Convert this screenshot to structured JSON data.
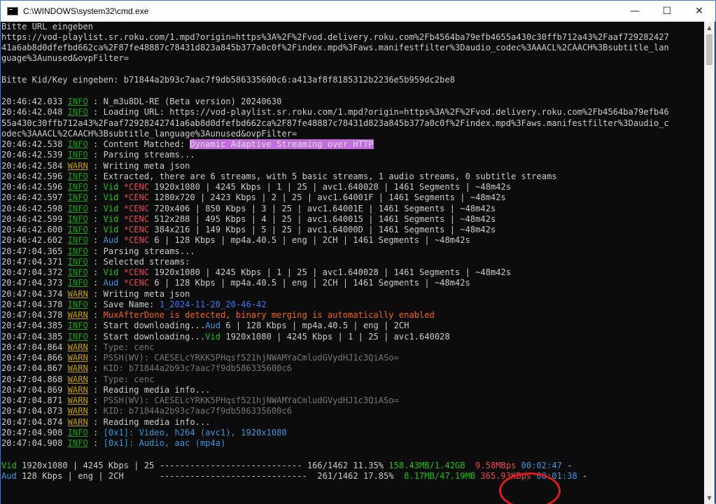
{
  "window": {
    "title": "C:\\WINDOWS\\system32\\cmd.exe",
    "minimize_label": "—",
    "maximize_label": "☐",
    "close_label": "✕"
  },
  "colors": {
    "info": "#3a96dd",
    "warn": "#c19c00",
    "highlight": "#c56de0",
    "circle": "#e01a1a"
  },
  "console": {
    "url_prompt": "Bitte URL eingeben",
    "url_line1": "https://vod-playlist.sr.roku.com/1.mpd?origin=https%3A%2F%2Fvod.delivery.roku.com%2Fb4564ba79efb4655a430c30ffb712a43%2Faaf729282427",
    "url_line2": "41a6ab8d0dfefbd662ca%2F87fe48887c78431d823a845b377a0c0f%2Findex.mpd%3Faws.manifestfilter%3Daudio_codec%3AAACL%2CAACH%3Bsubtitle_lan",
    "url_line3": "guage%3Aunused&ovpFilter=",
    "key_line": "Bitte Kid/Key eingeben: b71844a2b93c7aac7f9db586335600c6:a413af8f8185312b2236e5b959dc2be8",
    "log": [
      {
        "ts": "20:46:42.033",
        "lvl": "INFO",
        "parts": [
          {
            "t": " : N_m3u8DL-RE (Beta version) 20240630",
            "c": ""
          }
        ]
      },
      {
        "ts": "20:46:42.048",
        "lvl": "INFO",
        "parts": [
          {
            "t": " : Loading URL: https://vod-playlist.sr.roku.com/1.mpd?origin=https%3A%2F%2Fvod.delivery.roku.com%2Fb4564ba79efb46",
            "c": ""
          }
        ]
      },
      {
        "ts": "",
        "lvl": "",
        "parts": [
          {
            "t": "55a430c30ffb712a43%2Faaf72928242741a6ab8d0dfefbd662ca%2F87fe48887c78431d823a845b377a0c0f%2Findex.mpd%3Faws.manifestfilter%3Daudio_c",
            "c": ""
          }
        ]
      },
      {
        "ts": "",
        "lvl": "",
        "parts": [
          {
            "t": "odec%3AAACL%2CAACH%3Bsubtitle_language%3Aunused&ovpFilter=",
            "c": ""
          }
        ]
      },
      {
        "ts": "20:46:42.538",
        "lvl": "INFO",
        "parts": [
          {
            "t": " : Content Matched: ",
            "c": ""
          },
          {
            "t": "Dynamic Adaptive Streaming over HTTP",
            "c": "hl"
          }
        ]
      },
      {
        "ts": "20:46:42.539",
        "lvl": "INFO",
        "parts": [
          {
            "t": " : Parsing streams...",
            "c": ""
          }
        ]
      },
      {
        "ts": "20:46:42.584",
        "lvl": "WARN",
        "parts": [
          {
            "t": " : Writing meta json",
            "c": ""
          }
        ]
      },
      {
        "ts": "20:46:42.596",
        "lvl": "INFO",
        "parts": [
          {
            "t": " : Extracted, there are 6 streams, with 5 basic streams, 1 audio streams, 0 subtitle streams",
            "c": ""
          }
        ]
      },
      {
        "ts": "20:46:42.596",
        "lvl": "INFO",
        "parts": [
          {
            "t": " : ",
            "c": ""
          },
          {
            "t": "Vid",
            "c": "c-green"
          },
          {
            "t": " *CENC",
            "c": "c-red"
          },
          {
            "t": " 1920x1080 | 4245 Kbps | 1 | 25 | avc1.640028 | 1461 Segments | ~48m42s",
            "c": ""
          }
        ]
      },
      {
        "ts": "20:46:42.597",
        "lvl": "INFO",
        "parts": [
          {
            "t": " : ",
            "c": ""
          },
          {
            "t": "Vid",
            "c": "c-green"
          },
          {
            "t": " *CENC",
            "c": "c-red"
          },
          {
            "t": " 1280x720 | 2423 Kbps | 2 | 25 | avc1.64001F | 1461 Segments | ~48m42s",
            "c": ""
          }
        ]
      },
      {
        "ts": "20:46:42.598",
        "lvl": "INFO",
        "parts": [
          {
            "t": " : ",
            "c": ""
          },
          {
            "t": "Vid",
            "c": "c-green"
          },
          {
            "t": " *CENC",
            "c": "c-red"
          },
          {
            "t": " 720x406 | 850 Kbps | 3 | 25 | avc1.64001E | 1461 Segments | ~48m42s",
            "c": ""
          }
        ]
      },
      {
        "ts": "20:46:42.599",
        "lvl": "INFO",
        "parts": [
          {
            "t": " : ",
            "c": ""
          },
          {
            "t": "Vid",
            "c": "c-green"
          },
          {
            "t": " *CENC",
            "c": "c-red"
          },
          {
            "t": " 512x288 | 495 Kbps | 4 | 25 | avc1.640015 | 1461 Segments | ~48m42s",
            "c": ""
          }
        ]
      },
      {
        "ts": "20:46:42.600",
        "lvl": "INFO",
        "parts": [
          {
            "t": " : ",
            "c": ""
          },
          {
            "t": "Vid",
            "c": "c-green"
          },
          {
            "t": " *CENC",
            "c": "c-red"
          },
          {
            "t": " 384x216 | 149 Kbps | 5 | 25 | avc1.64000D | 1461 Segments | ~48m42s",
            "c": ""
          }
        ]
      },
      {
        "ts": "20:46:42.602",
        "lvl": "INFO",
        "parts": [
          {
            "t": " : ",
            "c": ""
          },
          {
            "t": "Aud",
            "c": "c-cyan"
          },
          {
            "t": " *CENC",
            "c": "c-red"
          },
          {
            "t": " 6 | 128 Kbps | mp4a.40.5 | eng | 2CH | 1461 Segments | ~48m42s",
            "c": ""
          }
        ]
      },
      {
        "ts": "20:47:04.365",
        "lvl": "INFO",
        "parts": [
          {
            "t": " : Parsing streams...",
            "c": ""
          }
        ]
      },
      {
        "ts": "20:47:04.371",
        "lvl": "INFO",
        "parts": [
          {
            "t": " : Selected streams:",
            "c": ""
          }
        ]
      },
      {
        "ts": "20:47:04.372",
        "lvl": "INFO",
        "parts": [
          {
            "t": " : ",
            "c": ""
          },
          {
            "t": "Vid",
            "c": "c-green"
          },
          {
            "t": " *CENC",
            "c": "c-red"
          },
          {
            "t": " 1920x1080 | 4245 Kbps | 1 | 25 | avc1.640028 | 1461 Segments | ~48m42s",
            "c": ""
          }
        ]
      },
      {
        "ts": "20:47:04.373",
        "lvl": "INFO",
        "parts": [
          {
            "t": " : ",
            "c": ""
          },
          {
            "t": "Aud",
            "c": "c-cyan"
          },
          {
            "t": " *CENC",
            "c": "c-red"
          },
          {
            "t": " 6 | 128 Kbps | mp4a.40.5 | eng | 2CH | 1461 Segments | ~48m42s",
            "c": ""
          }
        ]
      },
      {
        "ts": "20:47:04.374",
        "lvl": "WARN",
        "parts": [
          {
            "t": " : Writing meta json",
            "c": ""
          }
        ]
      },
      {
        "ts": "20:47:04.378",
        "lvl": "INFO",
        "parts": [
          {
            "t": " : Save Name: ",
            "c": ""
          },
          {
            "t": "1_2024-11-20_20-46-42",
            "c": "c-blue2"
          }
        ]
      },
      {
        "ts": "20:47:04.378",
        "lvl": "WARN",
        "parts": [
          {
            "t": " : ",
            "c": ""
          },
          {
            "t": "MuxAfterDone is detected, binary merging is automatically enabled",
            "c": "c-orange"
          }
        ]
      },
      {
        "ts": "20:47:04.385",
        "lvl": "INFO",
        "parts": [
          {
            "t": " : Start downloading...",
            "c": ""
          },
          {
            "t": "Aud",
            "c": "c-cyan"
          },
          {
            "t": " 6 | 128 Kbps | mp4a.40.5 | eng | 2CH",
            "c": ""
          }
        ]
      },
      {
        "ts": "20:47:04.385",
        "lvl": "INFO",
        "parts": [
          {
            "t": " : Start downloading...",
            "c": ""
          },
          {
            "t": "Vid",
            "c": "c-green"
          },
          {
            "t": " 1920x1080 | 4245 Kbps | 1 | 25 | avc1.640028",
            "c": ""
          }
        ]
      },
      {
        "ts": "20:47:04.864",
        "lvl": "WARN",
        "parts": [
          {
            "t": " : ",
            "c": ""
          },
          {
            "t": "Type: cenc",
            "c": "c-gray"
          }
        ]
      },
      {
        "ts": "20:47:04.866",
        "lvl": "WARN",
        "parts": [
          {
            "t": " : ",
            "c": ""
          },
          {
            "t": "PSSH(WV): CAESELcYRKK5PHqsf521hjNWAMYaCmludGVydHJ1c3QiASo=",
            "c": "c-gray"
          }
        ]
      },
      {
        "ts": "20:47:04.867",
        "lvl": "WARN",
        "parts": [
          {
            "t": " : ",
            "c": ""
          },
          {
            "t": "KID: b71844a2b93c7aac7f9db586335600c6",
            "c": "c-gray"
          }
        ]
      },
      {
        "ts": "20:47:04.868",
        "lvl": "WARN",
        "parts": [
          {
            "t": " : ",
            "c": ""
          },
          {
            "t": "Type: cenc",
            "c": "c-gray"
          }
        ]
      },
      {
        "ts": "20:47:04.869",
        "lvl": "WARN",
        "parts": [
          {
            "t": " : Reading media info...",
            "c": ""
          }
        ]
      },
      {
        "ts": "20:47:04.871",
        "lvl": "WARN",
        "parts": [
          {
            "t": " : ",
            "c": ""
          },
          {
            "t": "PSSH(WV): CAESELcYRKK5PHqsf521hjNWAMYaCmludGVydHJ1c3QiASo=",
            "c": "c-gray"
          }
        ]
      },
      {
        "ts": "20:47:04.873",
        "lvl": "WARN",
        "parts": [
          {
            "t": " : ",
            "c": ""
          },
          {
            "t": "KID: b71844a2b93c7aac7f9db586335600c6",
            "c": "c-gray"
          }
        ]
      },
      {
        "ts": "20:47:04.874",
        "lvl": "WARN",
        "parts": [
          {
            "t": " : Reading media info...",
            "c": ""
          }
        ]
      },
      {
        "ts": "20:47:04.908",
        "lvl": "INFO",
        "parts": [
          {
            "t": " : ",
            "c": ""
          },
          {
            "t": "[0x1]: Video, h264 (avc1), 1920x1080",
            "c": "c-cyan"
          }
        ]
      },
      {
        "ts": "20:47:04.908",
        "lvl": "INFO",
        "parts": [
          {
            "t": " : ",
            "c": ""
          },
          {
            "t": "[0x1]: Audio, aac (mp4a)",
            "c": "c-cyan"
          }
        ]
      }
    ],
    "progress": [
      {
        "parts": [
          {
            "t": "Vid",
            "c": "c-green"
          },
          {
            "t": " 1920x1080 | 4245 Kbps | 25 ---------------------------- 166/1462 11.35% ",
            "c": ""
          },
          {
            "t": "158.43MB/1.42GB",
            "c": "c-green"
          },
          {
            "t": "  9.58MBps",
            "c": "c-red"
          },
          {
            "t": " 00:02:47",
            "c": "c-cyan"
          },
          {
            "t": " -",
            "c": ""
          }
        ],
        "fraction": 0.1135
      },
      {
        "parts": [
          {
            "t": "Aud",
            "c": "c-cyan"
          },
          {
            "t": " 128 Kbps | eng | 2CH       -----------------------------  261/1462 17.85%  ",
            "c": ""
          },
          {
            "t": "8.17MB/47.19MB",
            "c": "c-green"
          },
          {
            "t": " 365.93KBps",
            "c": "c-red"
          },
          {
            "t": " 00:01:38",
            "c": "c-cyan"
          },
          {
            "t": " -",
            "c": ""
          }
        ],
        "fraction": 0.1785
      }
    ]
  }
}
